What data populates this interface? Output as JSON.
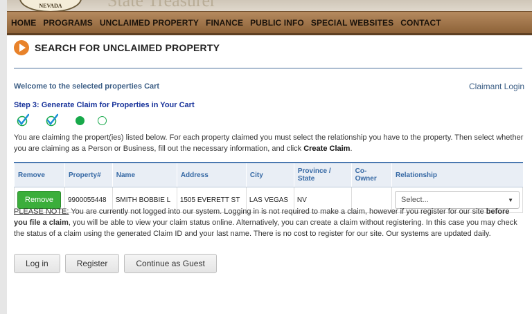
{
  "header": {
    "seal_text": "NEVADA",
    "banner_title": "State Treasurer"
  },
  "nav": {
    "items": [
      "HOME",
      "PROGRAMS",
      "UNCLAIMED PROPERTY",
      "FINANCE",
      "PUBLIC INFO",
      "SPECIAL WEBSITES",
      "CONTACT"
    ]
  },
  "page": {
    "title": "SEARCH FOR UNCLAIMED PROPERTY",
    "welcome": "Welcome to the selected properties Cart",
    "claimant_login": "Claimant Login",
    "step_title": "Step 3: Generate Claim for Properties in Your Cart",
    "steps": {
      "completed": 2,
      "current": 3,
      "total": 4
    },
    "intro_text": "You are claiming the propert(ies) listed below. For each property claimed you must select the relationship you have to the property. Then select whether you are claiming as a Person or Business, fill out the necessary information, and click ",
    "intro_bold": "Create Claim",
    "intro_end": "."
  },
  "table": {
    "headers": [
      "Remove",
      "Property#",
      "Name",
      "Address",
      "City",
      "Province / State",
      "Co-Owner",
      "Relationship"
    ],
    "rows": [
      {
        "remove_label": "Remove",
        "property": "9900055448",
        "name": "SMITH BOBBIE L",
        "address": "1505 EVERETT ST",
        "city": "LAS VEGAS",
        "state": "NV",
        "co_owner": "",
        "relationship": "Select..."
      }
    ]
  },
  "note": {
    "label": "PLEASE NOTE:",
    "text1": " You are currently not logged into our system. Logging in is not required to make a claim, however if you register for our site ",
    "bold": "before you file a claim",
    "text2": ", you will be able to view your claim status online. Alternatively, you can create a claim without registering. In this case you may check the status of a claim using the generated Claim ID and your last name. There is no cost to register for our site. Our systems are updated daily."
  },
  "buttons": {
    "login": "Log in",
    "register": "Register",
    "guest": "Continue as Guest"
  },
  "colors": {
    "nav_bg": "#a47a4e",
    "accent_orange": "#e8822a",
    "link_blue": "#3d5f86",
    "step_green": "#18a94b",
    "remove_green": "#3bae3b"
  }
}
